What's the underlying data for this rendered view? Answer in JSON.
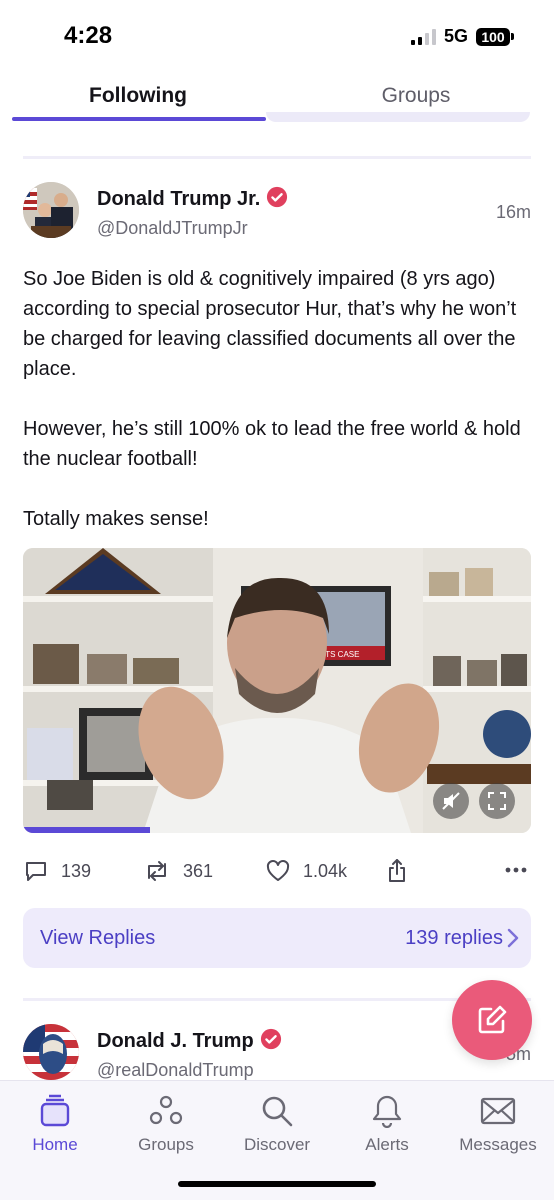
{
  "status_bar": {
    "time": "4:28",
    "network": "5G",
    "battery": "100"
  },
  "tabs": [
    {
      "label": "Following",
      "active": true
    },
    {
      "label": "Groups",
      "active": false
    }
  ],
  "post": {
    "author": "Donald Trump Jr.",
    "handle": "@DonaldJTrumpJr",
    "time": "16m",
    "paragraphs": [
      "So Joe Biden is old & cognitively impaired (8 yrs ago) according to special prosecutor Hur, that’s why he won’t be charged for leaving classified documents all over the place.",
      "However, he’s still 100% ok to lead the free world & hold the nuclear football!",
      "Totally makes sense!"
    ],
    "video": {
      "tv_text": "ED DOCUMENTS CASE",
      "progress": 0.25
    },
    "actions": {
      "replies": "139",
      "reposts": "361",
      "likes": "1.04k"
    },
    "replies_bar": {
      "label": "View Replies",
      "count": "139 replies"
    }
  },
  "next_post": {
    "author": "Donald J. Trump",
    "handle": "@realDonaldTrump",
    "time": "5m"
  },
  "bottom_nav": [
    {
      "label": "Home",
      "icon": "home-icon",
      "active": true
    },
    {
      "label": "Groups",
      "icon": "groups-icon",
      "active": false
    },
    {
      "label": "Discover",
      "icon": "search-icon",
      "active": false
    },
    {
      "label": "Alerts",
      "icon": "bell-icon",
      "active": false
    },
    {
      "label": "Messages",
      "icon": "envelope-icon",
      "active": false
    }
  ],
  "colors": {
    "accent": "#5b49d6",
    "fab": "#ea5a7a",
    "verified": "#e0405e",
    "replies_bg": "#eeebfb"
  }
}
